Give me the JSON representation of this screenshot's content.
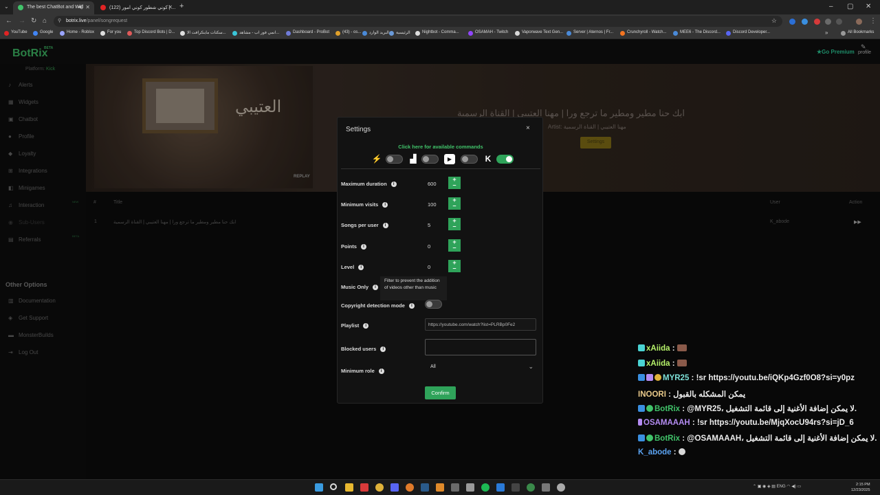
{
  "browser": {
    "tabs": [
      {
        "title": "The best ChatBot and Wid",
        "active": true,
        "favicon_color": "#41c36a"
      },
      {
        "title": "(122) كوني شطور كوني امور | ...",
        "active": false,
        "favicon_color": "#e02424"
      }
    ],
    "url_host": "botrix.live",
    "url_path": "/panel/songrequest",
    "bookmarks": [
      "YouTube",
      "Google",
      "Home - Roblox",
      "For you",
      "Top Discord Bots | D...",
      "سكنات ماينكرافت الا...",
      "انمي فور اب - مشاهد...",
      "Dashboard - ProBot",
      "(43) - os...",
      "البريد الوارد",
      "الرئيسية",
      "Nightbot - Comma...",
      "OSAMAH - Twitch",
      "Vaporwave Text Gen...",
      "Server | Aternos | Fr...",
      "Crunchyroll - Watch...",
      "MEE6 - The Discord...",
      "Discord Developer..."
    ],
    "all_bookmarks": "All Bookmarks"
  },
  "app": {
    "logo": "BotRix",
    "beta": "BETA",
    "premium": "Go Premium",
    "profile": "profile",
    "platform_label": "Platform:",
    "platform_value": "Kick"
  },
  "sidebar": {
    "items": [
      {
        "label": "Alerts",
        "icon": "bell-icon",
        "glyph": "♪"
      },
      {
        "label": "Widgets",
        "icon": "widgets-icon",
        "glyph": "▦"
      },
      {
        "label": "Chatbot",
        "icon": "chat-icon",
        "glyph": "▣"
      },
      {
        "label": "Profile",
        "icon": "user-icon",
        "glyph": "●"
      },
      {
        "label": "Loyalty",
        "icon": "loyalty-icon",
        "glyph": "◆"
      },
      {
        "label": "Integrations",
        "icon": "plug-icon",
        "glyph": "⊞"
      },
      {
        "label": "Minigames",
        "icon": "gamepad-icon",
        "glyph": "◧"
      },
      {
        "label": "Interaction",
        "icon": "music-icon",
        "glyph": "♫",
        "badge": "NEW"
      },
      {
        "label": "Sub-Users",
        "icon": "users-icon",
        "glyph": "◉"
      },
      {
        "label": "Referrals",
        "icon": "referrals-icon",
        "glyph": "▤",
        "badge": "BETA"
      }
    ],
    "other_options_title": "Other Options",
    "other_items": [
      {
        "label": "Documentation",
        "icon": "book-icon",
        "glyph": "▥"
      },
      {
        "label": "Get Support",
        "icon": "support-icon",
        "glyph": "◈"
      },
      {
        "label": "MonsterBuilds",
        "icon": "monster-icon",
        "glyph": "▬"
      },
      {
        "label": "Log Out",
        "icon": "logout-icon",
        "glyph": "⇥"
      }
    ]
  },
  "now_playing": {
    "title": "ابك حنا مطير ومطير ما ترجع ورا | مهنا العتيبي | القناة الرسمية",
    "artist_label": "Artist:",
    "artist": "مهنا العتيبي | القناة الرسمية",
    "settings_button": "Settings",
    "thumb_text": "العتيبي",
    "replay": "REPLAY"
  },
  "queue": {
    "headers": {
      "index": "#",
      "title": "Title",
      "user": "User",
      "action": "Action"
    },
    "rows": [
      {
        "index": "1",
        "title": "ابك حنا مطير ومطير ما ترجع ورا | مهنا العتيبي | القناة الرسمية",
        "user": "K_abode",
        "action": "▶▶"
      }
    ]
  },
  "modal": {
    "title": "Settings",
    "close": "×",
    "commands_link": "Click here for available commands",
    "platforms": [
      {
        "name": "kick-logo-icon",
        "glyph": "⚡",
        "enabled": false
      },
      {
        "name": "twitch-icon",
        "glyph": "▟",
        "enabled": false
      },
      {
        "name": "youtube-icon",
        "glyph": "▶",
        "enabled": false
      },
      {
        "name": "kick-k-icon",
        "glyph": "K",
        "enabled": true
      }
    ],
    "fields": {
      "max_duration": {
        "label": "Maximum duration",
        "value": "600"
      },
      "min_visits": {
        "label": "Minimum visits",
        "value": "100"
      },
      "songs_per_user": {
        "label": "Songs per user",
        "value": "5"
      },
      "points": {
        "label": "Points",
        "value": "0"
      },
      "level": {
        "label": "Level",
        "value": "0"
      },
      "music_only": {
        "label": "Music Only"
      },
      "copyright": {
        "label": "Copyright detection mode",
        "enabled": false
      },
      "playlist": {
        "label": "Playlist",
        "value": "https://youtube.com/watch?list=PLRBp0Fe2"
      },
      "blocked_users": {
        "label": "Blocked users",
        "value": ""
      },
      "minimum_role": {
        "label": "Minimum role",
        "value": "All"
      }
    },
    "tooltip": "Filter to prevent the addition of videos other than music",
    "confirm": "Confirm"
  },
  "chat": [
    {
      "user": "xAiida",
      "sep": " :",
      "message": "",
      "color": "#b6f26a"
    },
    {
      "user": "xAiida",
      "sep": " :",
      "message": "",
      "color": "#b6f26a"
    },
    {
      "user": "MYR25",
      "sep": " :",
      "message": " !sr https://youtu.be/iQKp4Gzf0O8?si=y0pz",
      "color": "#7de0d8"
    },
    {
      "user": "INOORI",
      "sep": " :",
      "message": " يمكن المشكله بالقبول",
      "color": "#e9c98a"
    },
    {
      "user": "BotRix",
      "sep": " :",
      "message": " @MYR25، لا يمكن إضافة الأغنية إلى قائمة التشغيل.",
      "color": "#41c36a"
    },
    {
      "user": "OSAMAAAH",
      "sep": " :",
      "message": " !sr https://youtu.be/MjqXocU94rs?si=jD_6",
      "color": "#b48cf2"
    },
    {
      "user": "BotRix",
      "sep": " :",
      "message": " @OSAMAAAH، لا يمكن إضافة الأغنية إلى قائمة التشغيل.",
      "color": "#41c36a"
    },
    {
      "user": "K_abode",
      "sep": " :",
      "message": "",
      "color": "#5aa2f0"
    }
  ],
  "taskbar": {
    "lang": "ENG",
    "time": "2:15 PM",
    "date": "12/23/2025"
  }
}
